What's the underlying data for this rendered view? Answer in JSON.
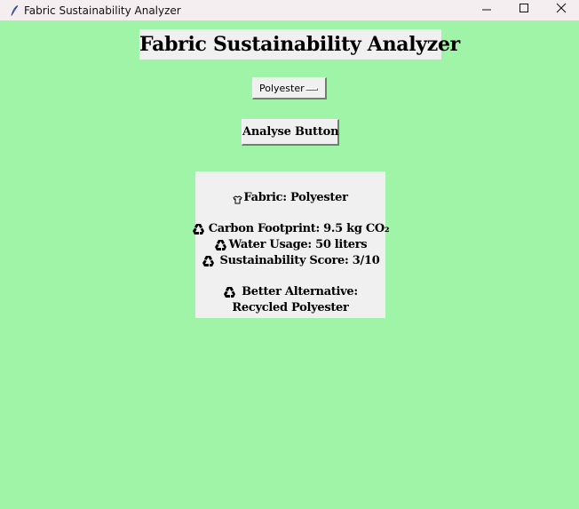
{
  "window": {
    "title": "Fabric Sustainability Analyzer",
    "icon": "feather-icon"
  },
  "header": {
    "title": "Fabric Sustainability Analyzer"
  },
  "fabric_select": {
    "value": "Polyester"
  },
  "analyse_button": {
    "label": "Analyse Button"
  },
  "results": {
    "fabric_line": "Fabric: Polyester",
    "carbon_line": "Carbon Footprint: 9.5 kg CO₂",
    "water_line": "Water Usage: 50 liters",
    "score_line": "Sustainability Score: 3/10",
    "alternative_label": "Better Alternative:",
    "alternative_value": "Recycled Polyester",
    "icons": [
      "shirt-icon",
      "recycle-icon"
    ]
  },
  "colors": {
    "background": "#a0f4a8",
    "panel": "#f0f0f0",
    "titlebar": "#f5eef0"
  }
}
